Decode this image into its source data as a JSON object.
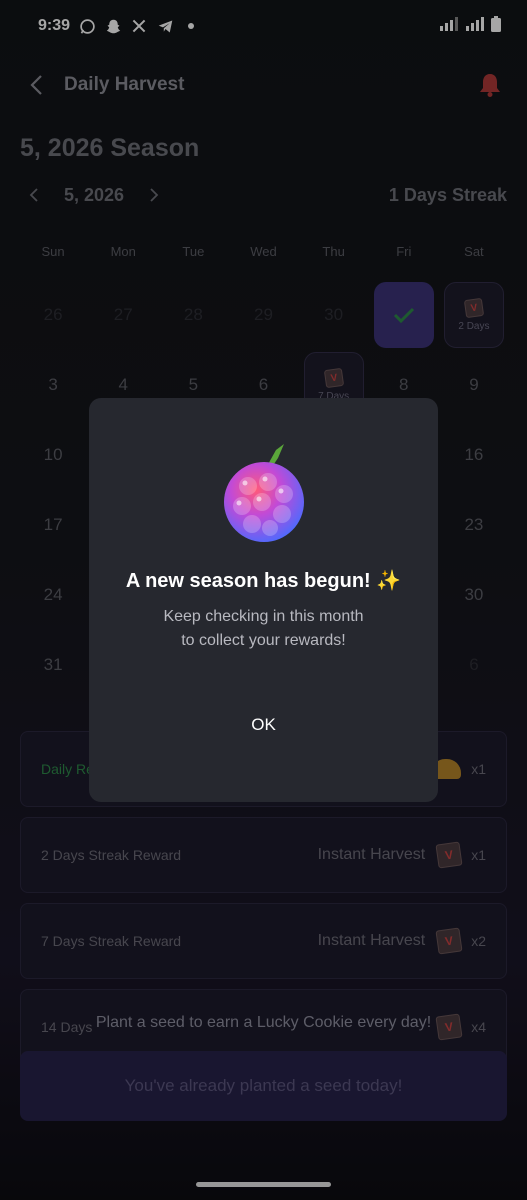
{
  "status": {
    "time": "9:39"
  },
  "header": {
    "title": "Daily Harvest"
  },
  "season_title": "5, 2026 Season",
  "month_label": "5, 2026",
  "streak_label": "1 Days Streak",
  "weekdays": [
    "Sun",
    "Mon",
    "Tue",
    "Wed",
    "Thu",
    "Fri",
    "Sat"
  ],
  "calendar": {
    "row1": [
      "26",
      "27",
      "28",
      "29",
      "30"
    ],
    "sat1_label": "2 Days",
    "row2": [
      "3",
      "4",
      "5",
      "6"
    ],
    "thu2_label": "7 Days",
    "row2_end": [
      "8",
      "9"
    ],
    "left_col": [
      "10",
      "17",
      "24",
      "31"
    ],
    "right_col": [
      "16",
      "23",
      "30"
    ],
    "last_dim": "6"
  },
  "rewards": [
    {
      "name": "Daily Re",
      "prize": "",
      "qty": "x1"
    },
    {
      "name": "2 Days Streak Reward",
      "prize": "Instant Harvest",
      "qty": "x1"
    },
    {
      "name": "7 Days Streak Reward",
      "prize": "Instant Harvest",
      "qty": "x2"
    },
    {
      "name": "14 Days",
      "prize": "",
      "qty": "x4"
    }
  ],
  "bottom_text": "Plant a seed to earn a Lucky Cookie every day!",
  "cta_label": "You've already planted a seed today!",
  "modal": {
    "title": "A new season has begun! ✨",
    "line1": "Keep checking in this month",
    "line2": "to collect your rewards!",
    "ok": "OK"
  },
  "colors": {
    "accent": "#3c3478",
    "reward_green": "#2e8a4a",
    "bell": "#b03a3a"
  }
}
